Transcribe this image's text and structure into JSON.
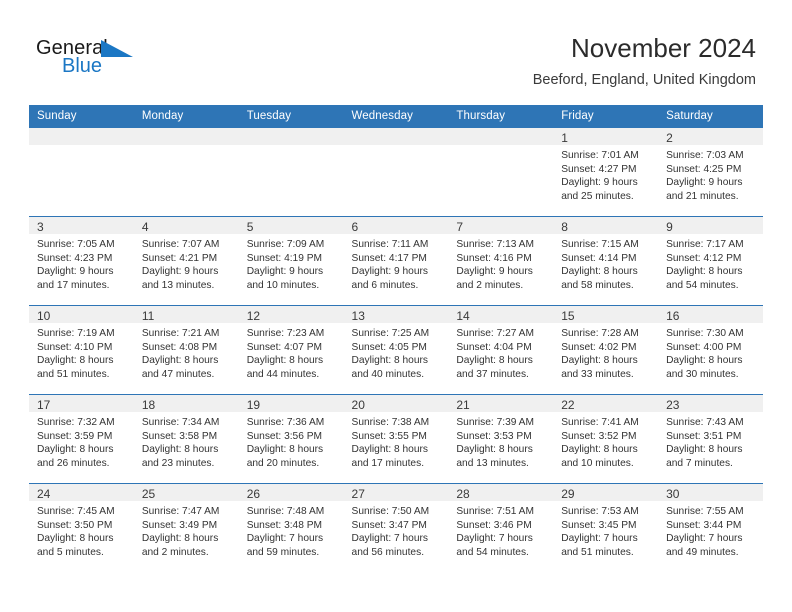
{
  "brand": {
    "name_top": "General",
    "name_bottom": "Blue",
    "flag_color": "#1B77C4",
    "icon": "triangle-flag-icon"
  },
  "header": {
    "title": "November 2024",
    "location": "Beeford, England, United Kingdom",
    "header_bg": "#2E75B6",
    "daynum_band_bg": "#F0F0F0"
  },
  "weekday_headers": [
    "Sunday",
    "Monday",
    "Tuesday",
    "Wednesday",
    "Thursday",
    "Friday",
    "Saturday"
  ],
  "weeks": [
    [
      {
        "day": "",
        "lines": []
      },
      {
        "day": "",
        "lines": []
      },
      {
        "day": "",
        "lines": []
      },
      {
        "day": "",
        "lines": []
      },
      {
        "day": "",
        "lines": []
      },
      {
        "day": "1",
        "lines": [
          "Sunrise: 7:01 AM",
          "Sunset: 4:27 PM",
          "Daylight: 9 hours",
          "and 25 minutes."
        ]
      },
      {
        "day": "2",
        "lines": [
          "Sunrise: 7:03 AM",
          "Sunset: 4:25 PM",
          "Daylight: 9 hours",
          "and 21 minutes."
        ]
      }
    ],
    [
      {
        "day": "3",
        "lines": [
          "Sunrise: 7:05 AM",
          "Sunset: 4:23 PM",
          "Daylight: 9 hours",
          "and 17 minutes."
        ]
      },
      {
        "day": "4",
        "lines": [
          "Sunrise: 7:07 AM",
          "Sunset: 4:21 PM",
          "Daylight: 9 hours",
          "and 13 minutes."
        ]
      },
      {
        "day": "5",
        "lines": [
          "Sunrise: 7:09 AM",
          "Sunset: 4:19 PM",
          "Daylight: 9 hours",
          "and 10 minutes."
        ]
      },
      {
        "day": "6",
        "lines": [
          "Sunrise: 7:11 AM",
          "Sunset: 4:17 PM",
          "Daylight: 9 hours",
          "and 6 minutes."
        ]
      },
      {
        "day": "7",
        "lines": [
          "Sunrise: 7:13 AM",
          "Sunset: 4:16 PM",
          "Daylight: 9 hours",
          "and 2 minutes."
        ]
      },
      {
        "day": "8",
        "lines": [
          "Sunrise: 7:15 AM",
          "Sunset: 4:14 PM",
          "Daylight: 8 hours",
          "and 58 minutes."
        ]
      },
      {
        "day": "9",
        "lines": [
          "Sunrise: 7:17 AM",
          "Sunset: 4:12 PM",
          "Daylight: 8 hours",
          "and 54 minutes."
        ]
      }
    ],
    [
      {
        "day": "10",
        "lines": [
          "Sunrise: 7:19 AM",
          "Sunset: 4:10 PM",
          "Daylight: 8 hours",
          "and 51 minutes."
        ]
      },
      {
        "day": "11",
        "lines": [
          "Sunrise: 7:21 AM",
          "Sunset: 4:08 PM",
          "Daylight: 8 hours",
          "and 47 minutes."
        ]
      },
      {
        "day": "12",
        "lines": [
          "Sunrise: 7:23 AM",
          "Sunset: 4:07 PM",
          "Daylight: 8 hours",
          "and 44 minutes."
        ]
      },
      {
        "day": "13",
        "lines": [
          "Sunrise: 7:25 AM",
          "Sunset: 4:05 PM",
          "Daylight: 8 hours",
          "and 40 minutes."
        ]
      },
      {
        "day": "14",
        "lines": [
          "Sunrise: 7:27 AM",
          "Sunset: 4:04 PM",
          "Daylight: 8 hours",
          "and 37 minutes."
        ]
      },
      {
        "day": "15",
        "lines": [
          "Sunrise: 7:28 AM",
          "Sunset: 4:02 PM",
          "Daylight: 8 hours",
          "and 33 minutes."
        ]
      },
      {
        "day": "16",
        "lines": [
          "Sunrise: 7:30 AM",
          "Sunset: 4:00 PM",
          "Daylight: 8 hours",
          "and 30 minutes."
        ]
      }
    ],
    [
      {
        "day": "17",
        "lines": [
          "Sunrise: 7:32 AM",
          "Sunset: 3:59 PM",
          "Daylight: 8 hours",
          "and 26 minutes."
        ]
      },
      {
        "day": "18",
        "lines": [
          "Sunrise: 7:34 AM",
          "Sunset: 3:58 PM",
          "Daylight: 8 hours",
          "and 23 minutes."
        ]
      },
      {
        "day": "19",
        "lines": [
          "Sunrise: 7:36 AM",
          "Sunset: 3:56 PM",
          "Daylight: 8 hours",
          "and 20 minutes."
        ]
      },
      {
        "day": "20",
        "lines": [
          "Sunrise: 7:38 AM",
          "Sunset: 3:55 PM",
          "Daylight: 8 hours",
          "and 17 minutes."
        ]
      },
      {
        "day": "21",
        "lines": [
          "Sunrise: 7:39 AM",
          "Sunset: 3:53 PM",
          "Daylight: 8 hours",
          "and 13 minutes."
        ]
      },
      {
        "day": "22",
        "lines": [
          "Sunrise: 7:41 AM",
          "Sunset: 3:52 PM",
          "Daylight: 8 hours",
          "and 10 minutes."
        ]
      },
      {
        "day": "23",
        "lines": [
          "Sunrise: 7:43 AM",
          "Sunset: 3:51 PM",
          "Daylight: 8 hours",
          "and 7 minutes."
        ]
      }
    ],
    [
      {
        "day": "24",
        "lines": [
          "Sunrise: 7:45 AM",
          "Sunset: 3:50 PM",
          "Daylight: 8 hours",
          "and 5 minutes."
        ]
      },
      {
        "day": "25",
        "lines": [
          "Sunrise: 7:47 AM",
          "Sunset: 3:49 PM",
          "Daylight: 8 hours",
          "and 2 minutes."
        ]
      },
      {
        "day": "26",
        "lines": [
          "Sunrise: 7:48 AM",
          "Sunset: 3:48 PM",
          "Daylight: 7 hours",
          "and 59 minutes."
        ]
      },
      {
        "day": "27",
        "lines": [
          "Sunrise: 7:50 AM",
          "Sunset: 3:47 PM",
          "Daylight: 7 hours",
          "and 56 minutes."
        ]
      },
      {
        "day": "28",
        "lines": [
          "Sunrise: 7:51 AM",
          "Sunset: 3:46 PM",
          "Daylight: 7 hours",
          "and 54 minutes."
        ]
      },
      {
        "day": "29",
        "lines": [
          "Sunrise: 7:53 AM",
          "Sunset: 3:45 PM",
          "Daylight: 7 hours",
          "and 51 minutes."
        ]
      },
      {
        "day": "30",
        "lines": [
          "Sunrise: 7:55 AM",
          "Sunset: 3:44 PM",
          "Daylight: 7 hours",
          "and 49 minutes."
        ]
      }
    ]
  ]
}
